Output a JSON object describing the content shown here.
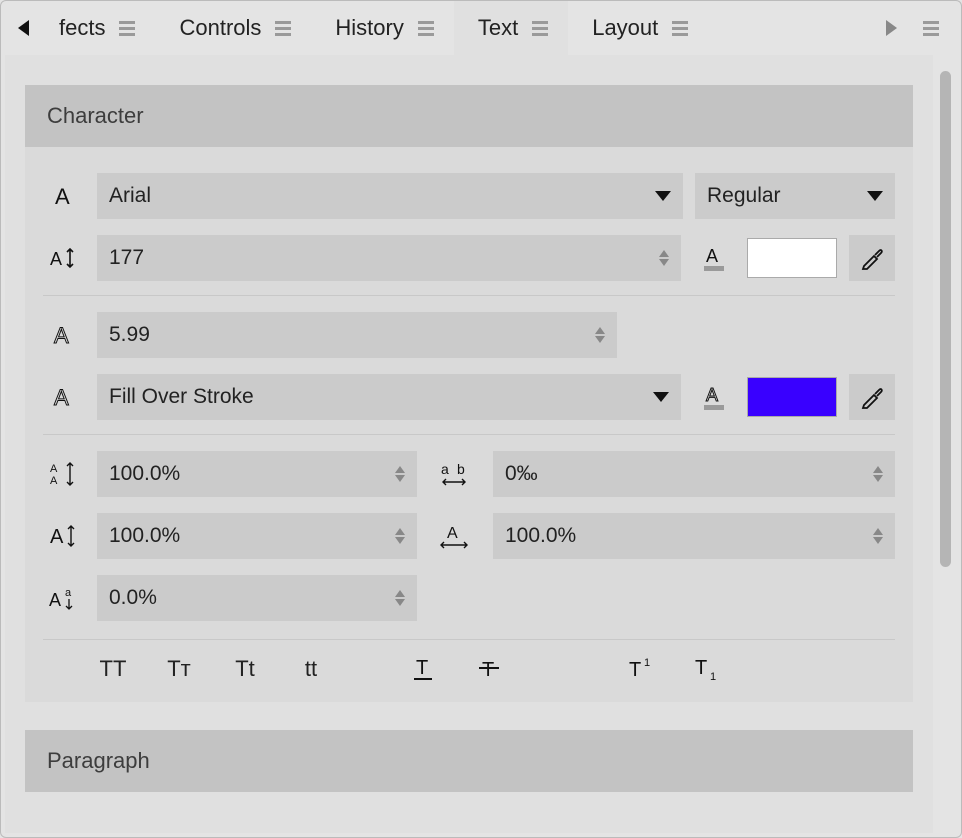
{
  "tabs": [
    {
      "label": "fects"
    },
    {
      "label": "Controls"
    },
    {
      "label": "History"
    },
    {
      "label": "Text"
    },
    {
      "label": "Layout"
    }
  ],
  "active_tab_index": 3,
  "panels": {
    "character": {
      "title": "Character",
      "font_family": "Arial",
      "font_style": "Regular",
      "font_size": "177",
      "fill_color": "#ffffff",
      "stroke_width": "5.99",
      "stroke_mode": "Fill Over Stroke",
      "stroke_color": "#3900ff",
      "line_height": "100.0%",
      "tracking": "0‰",
      "vertical_scale": "100.0%",
      "horizontal_scale": "100.0%",
      "baseline_shift": "0.0%",
      "case_buttons": [
        "TT",
        "Tᴛ",
        "Tt",
        "tt"
      ],
      "deco_buttons": [
        "underline",
        "strikethrough"
      ],
      "script_buttons": [
        "superscript",
        "subscript"
      ]
    },
    "paragraph": {
      "title": "Paragraph"
    }
  }
}
